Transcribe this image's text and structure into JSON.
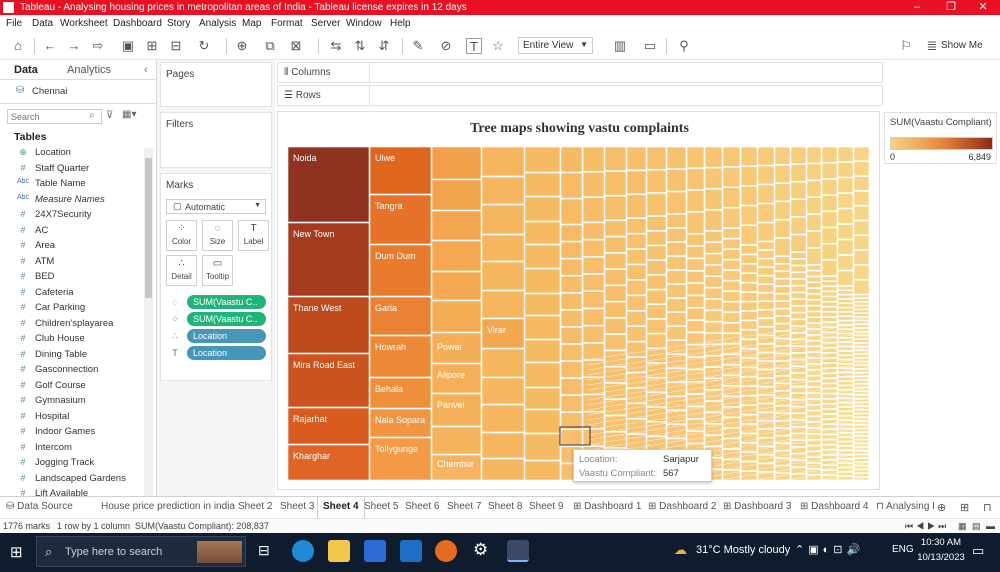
{
  "window": {
    "title": "Tableau - Analysing housing prices in metropolitan areas of India - Tableau license expires in 12 days",
    "controls": [
      "–",
      "❐",
      "✕"
    ]
  },
  "menu": [
    "File",
    "Data",
    "Worksheet",
    "Dashboard",
    "Story",
    "Analysis",
    "Map",
    "Format",
    "Server",
    "Window",
    "Help"
  ],
  "toolbar": {
    "view_mode": "Entire View",
    "show_me": "Show Me"
  },
  "left_panel": {
    "tabs": [
      "Data",
      "Analytics"
    ],
    "datasource": "Chennai",
    "search_placeholder": "Search",
    "tables_header": "Tables",
    "fields": [
      {
        "icon": "⊕",
        "name": "Location"
      },
      {
        "icon": "#",
        "name": "Staff Quarter"
      },
      {
        "icon": "Abc",
        "name": "Table Name"
      },
      {
        "icon": "Abc",
        "name": "Measure Names"
      },
      {
        "icon": "#",
        "name": "24X7Security"
      },
      {
        "icon": "#",
        "name": "AC"
      },
      {
        "icon": "#",
        "name": "Area"
      },
      {
        "icon": "#",
        "name": "ATM"
      },
      {
        "icon": "#",
        "name": "BED"
      },
      {
        "icon": "#",
        "name": "Cafeteria"
      },
      {
        "icon": "#",
        "name": "Car Parking"
      },
      {
        "icon": "#",
        "name": "Children'splayarea"
      },
      {
        "icon": "#",
        "name": "Club House"
      },
      {
        "icon": "#",
        "name": "Dining Table"
      },
      {
        "icon": "#",
        "name": "Gasconnection"
      },
      {
        "icon": "#",
        "name": "Golf Course"
      },
      {
        "icon": "#",
        "name": "Gymnasium"
      },
      {
        "icon": "#",
        "name": "Hospital"
      },
      {
        "icon": "#",
        "name": "Indoor Games"
      },
      {
        "icon": "#",
        "name": "Intercom"
      },
      {
        "icon": "#",
        "name": "Jogging Track"
      },
      {
        "icon": "#",
        "name": "Landscaped Gardens"
      },
      {
        "icon": "#",
        "name": "Lift Available"
      }
    ]
  },
  "cards": {
    "pages": "Pages",
    "filters": "Filters",
    "marks": "Marks",
    "mark_type": "Automatic",
    "mark_buttons": [
      {
        "icon": "⁘",
        "label": "Color"
      },
      {
        "icon": "◌",
        "label": "Size"
      },
      {
        "icon": "T",
        "label": "Label"
      },
      {
        "icon": "∴",
        "label": "Detail"
      },
      {
        "icon": "▭",
        "label": "Tooltip"
      }
    ],
    "pills": [
      {
        "icon": "◌",
        "text": "SUM(Vaastu C..",
        "color": "#1fb57a"
      },
      {
        "icon": "⁘",
        "text": "SUM(Vaastu C..",
        "color": "#1fb57a"
      },
      {
        "icon": "∴",
        "text": "Location",
        "color": "#4596b9"
      },
      {
        "icon": "T",
        "text": "Location",
        "color": "#4596b9"
      }
    ]
  },
  "shelves": {
    "columns": "Columns",
    "rows": "Rows"
  },
  "view": {
    "title": "Tree maps showing vastu complaints",
    "labels": [
      "Noida",
      "New Town",
      "Thane West",
      "Mira Road East",
      "Rajarhat",
      "Kharghar",
      "Ulwe",
      "Tangra",
      "Dum Dum",
      "Garia",
      "Howrah",
      "Behala",
      "Nala Sopara",
      "Tollygunge",
      "Powai",
      "Alipore",
      "Panvel",
      "Chembur",
      "Virar"
    ]
  },
  "tooltip": {
    "location_label": "Location:",
    "location_value": "Sarjapur",
    "measure_label": "Vaastu Compliant:",
    "measure_value": "567"
  },
  "legend": {
    "title": "SUM(Vaastu Compliant)",
    "min": "0",
    "max": "6,849",
    "color_low": "#f6d38a",
    "color_high": "#8e2a16"
  },
  "sheet_tabs": [
    "Data Source",
    "House price prediction in india",
    "Sheet 2",
    "Sheet 3",
    "Sheet 4",
    "Sheet 5",
    "Sheet 6",
    "Sheet 7",
    "Sheet 8",
    "Sheet 9",
    "Dashboard 1",
    "Dashboard 2",
    "Dashboard 3",
    "Dashboard 4",
    "Analysing I"
  ],
  "active_sheet": "Sheet 4",
  "status": {
    "marks": "1776 marks",
    "rows_cols": "1 row by 1 column",
    "sum": "SUM(Vaastu Compliant): 208,837"
  },
  "taskbar": {
    "search_placeholder": "Type here to search",
    "weather": "31°C  Mostly cloudy",
    "lang": "ENG",
    "time": "10:30 AM",
    "date": "10/13/2023"
  }
}
